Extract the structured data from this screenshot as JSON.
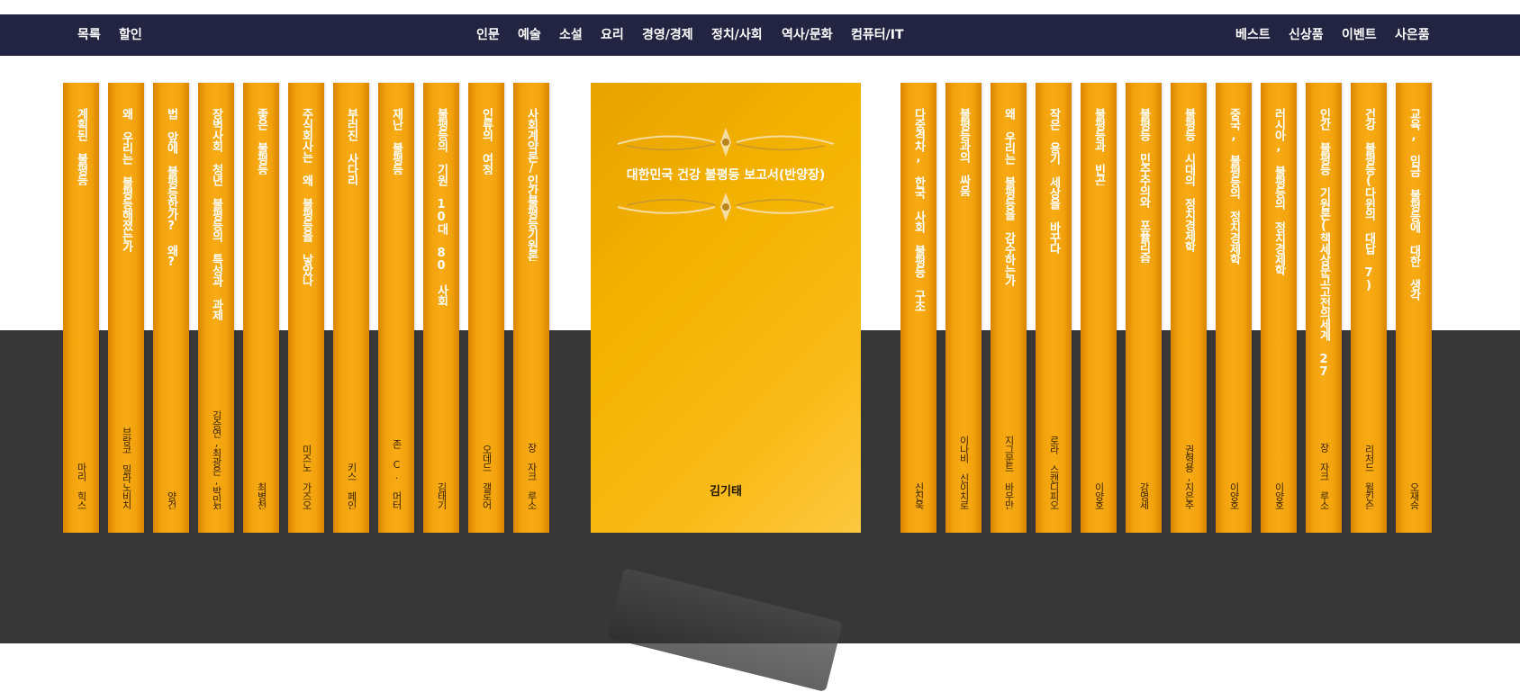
{
  "nav": {
    "left": [
      "목록",
      "할인"
    ],
    "center": [
      "인문",
      "예술",
      "소설",
      "요리",
      "경영/경제",
      "정치/사회",
      "역사/문화",
      "컴퓨터/IT"
    ],
    "right": [
      "베스트",
      "신상품",
      "이벤트",
      "사은품"
    ]
  },
  "featured": {
    "title": "대한민국 건강 불평등 보고서(반양장)",
    "author": "김기태"
  },
  "books_left": [
    {
      "title": "계획된 불평등",
      "author": "마리 힉스"
    },
    {
      "title": "왜 우리는 불평등해졌는가",
      "author": "브랑코 밀라노비치"
    },
    {
      "title": "법 앞에 불평등한가? 왜?",
      "author": "양건"
    },
    {
      "title": "장벽사회 청년 불평등의 특성과 과제",
      "author": "김승연,최광은,박민진"
    },
    {
      "title": "좋은 불평등",
      "author": "최병천"
    },
    {
      "title": "주식회사는 왜 불평등을 낳았나",
      "author": "미즈노 가즈오"
    },
    {
      "title": "부러진 사다리",
      "author": "키스 페인"
    },
    {
      "title": "재난 불평등",
      "author": "존 C. 머터"
    },
    {
      "title": "불평등의 기원 10대 80 사회",
      "author": "김태기"
    },
    {
      "title": "인류의 여정",
      "author": "오데드 갤로어"
    },
    {
      "title": "사회계약론/인간불평등기원론",
      "author": "장 자크 루소"
    }
  ],
  "books_right": [
    {
      "title": "다중격차, 한국 사회 불평등 구조",
      "author": "신진욱"
    },
    {
      "title": "불평등과의 싸움",
      "author": "이나비 신이치로"
    },
    {
      "title": "왜 우리는 불평등을 감수하는가",
      "author": "지그문트 바우만"
    },
    {
      "title": "작은 용기 세상을 바꾸다",
      "author": "로라 스캔디피오"
    },
    {
      "title": "불평등과 빈곤",
      "author": "이양호"
    },
    {
      "title": "불평등 민주주의와 포퓰리즘",
      "author": "강명세"
    },
    {
      "title": "불평등 시대의 정치경제학",
      "author": "권혁용,지은주"
    },
    {
      "title": "중국, 불평등의 정치경제학",
      "author": "이양호"
    },
    {
      "title": "러시아, 불평등의 정치경제학",
      "author": "이양호"
    },
    {
      "title": "인간 불평등 기원론(책세상문고고전의세계 27)",
      "author": "장 자크 루소"
    },
    {
      "title": "건강 불평등(다윈의 대답 7)",
      "author": "리처드 윌킨슨"
    },
    {
      "title": "교육, 임금 불평등에 대한 생각",
      "author": "오재승"
    }
  ],
  "colors": {
    "nav_bg": "#222442",
    "spine": "#f2a20c",
    "featured": "#f4b300",
    "floor": "#373737"
  }
}
